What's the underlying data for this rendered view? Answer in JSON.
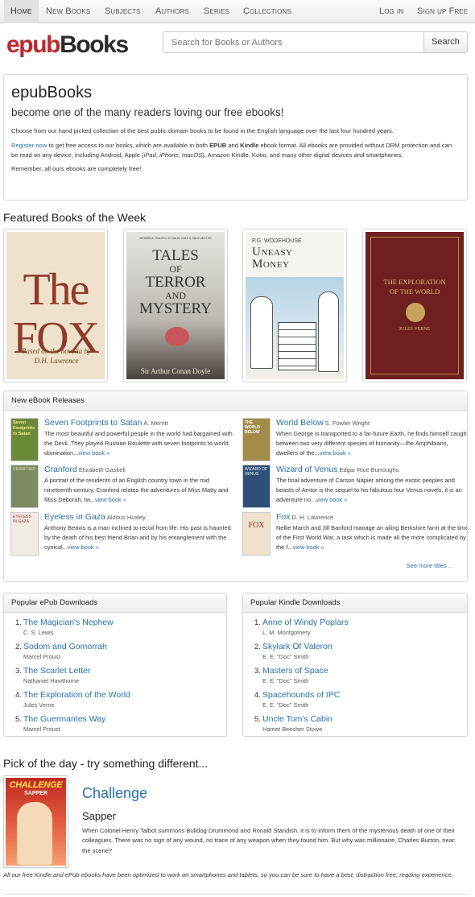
{
  "nav": {
    "home": "Home",
    "new_books": "New Books",
    "subjects": "Subjects",
    "authors": "Authors",
    "series": "Series",
    "collections": "Collections",
    "login": "Log in",
    "signup": "Sign up Free"
  },
  "header": {
    "logo_part1": "epub",
    "logo_part2": "Books",
    "search_placeholder": "Search for Books or Authors",
    "search_button": "Search"
  },
  "intro": {
    "title": "epubBooks",
    "subtitle": "become one of the many readers loving our free ebooks!",
    "para1": "Choose from our hand picked collection of the best public domain books to be found in the English language over the last four hundred years.",
    "register_link": "Register now",
    "para2_a": " to get free access to our books, which are available in both ",
    "epub": "EPUB",
    "and": " and ",
    "kindle": "Kindle",
    "para2_b": " ebook format. All ebooks are provided without DRM protection and can be read on any device, including Android, Apple (",
    "ipad": "iPad",
    "comma1": ", ",
    "iphone": "iPhone",
    "comma2": ", ",
    "macos": "macOS",
    "para2_c": "), Amazon Kindle, Kobo, and many other digital devices and smartphones.",
    "para3": "Remember, all ours ebooks are completely free!"
  },
  "featured": {
    "title": "Featured Books of the Week",
    "books": [
      {
        "cover_title": "The FOX",
        "cover_sub": "Based on the novella by D.H. Lawrence"
      },
      {
        "cover_series": "MEMBRAK TRAJTEO DI SALIK, KALS & SALIK MISTER",
        "cover_title_1": "TALES",
        "cover_title_2": "OF",
        "cover_title_3": "TERROR",
        "cover_title_4": "AND",
        "cover_title_5": "MYSTERY",
        "cover_author": "Sir Arthur Conan Doyle"
      },
      {
        "cover_author": "P.G. WODEHOUSE",
        "cover_title_1": "Uneasy",
        "cover_title_2": "Money"
      },
      {
        "cover_title_1": "THE EXPLORATION",
        "cover_title_2": "OF THE WORLD",
        "cover_author": "JULES VERNE"
      }
    ]
  },
  "releases": {
    "title": "New eBook Releases",
    "see_more": "See more titles ...",
    "view_book": "view book »",
    "items": [
      {
        "title": "Seven Footprints to Satan",
        "author": "A. Merritt",
        "desc": "The most beautiful and powerful people in the world had bargained with the Devil. They played Russian Roulette with seven footprints to world domination...",
        "thumb_text": "Seven Footprints to Satan"
      },
      {
        "title": "World Below",
        "author": "S. Fowler Wright",
        "desc": "When George is transported to a far-future Earth, he finds himself caught between two very different species of humanity—the Amphibians, dwellers of the...",
        "thumb_text": "THE WORLD BELOW"
      },
      {
        "title": "Cranford",
        "author": "Elizabeth Gaskell",
        "desc": "A portrait of the residents of an English country town in the mid nineteenth century, Cranford relates the adventures of Miss Matty and Miss Deborah, tw...",
        "thumb_text": "CRANFORD"
      },
      {
        "title": "Wizard of Venus",
        "author": "Edgar Rice Burroughs",
        "desc": "The final adventure of Carson Napier among the exotic peoples and beasts of Amtor is the sequel to his fabulous four Venus novels, it is an adventure no...",
        "thumb_text": "WIZARD OF VENUS"
      },
      {
        "title": "Eyeless in Gaza",
        "author": "Aldous Huxley",
        "desc": "Anthony Beavis is a man inclined to recoil from life. His past is haunted by the death of his best friend Brian and by his entanglement with the cynical...",
        "thumb_text": "EYELESS IN GAZA"
      },
      {
        "title": "Fox",
        "author": "D. H. Lawrence",
        "desc": "Nellie March and Jill Banford manage an ailing Berkshire farm at the time of the First World War, a task which is made all the more complicated by the f...",
        "thumb_text": "FOX"
      }
    ]
  },
  "popular_epub": {
    "title": "Popular ePub Downloads",
    "items": [
      {
        "num": "1.",
        "title": "The Magician's Nephew",
        "author": "C. S. Lewis"
      },
      {
        "num": "2.",
        "title": "Sodom and Gomorrah",
        "author": "Marcel Proust"
      },
      {
        "num": "3.",
        "title": "The Scarlet Letter",
        "author": "Nathaniel Hawthorne"
      },
      {
        "num": "4.",
        "title": "The Exploration of the World",
        "author": "Jules Verne"
      },
      {
        "num": "5.",
        "title": "The Guermantes Way",
        "author": "Marcel Proust"
      }
    ]
  },
  "popular_kindle": {
    "title": "Popular Kindle Downloads",
    "items": [
      {
        "num": "1.",
        "title": "Anne of Windy Poplars",
        "author": "L. M. Montgomery"
      },
      {
        "num": "2.",
        "title": "Skylark Of Valeron",
        "author": "E. E. \"Doc\" Smith"
      },
      {
        "num": "3.",
        "title": "Masters of Space",
        "author": "E. E. \"Doc\" Smith"
      },
      {
        "num": "4.",
        "title": "Spacehounds of IPC",
        "author": "E. E. \"Doc\" Smith"
      },
      {
        "num": "5.",
        "title": "Uncle Tom's Cabin",
        "author": "Harriet Beecher Stowe"
      }
    ]
  },
  "pick": {
    "heading": "Pick of the day - try something different...",
    "title": "Challenge",
    "author": "Sapper",
    "desc": "When Colonel Henry Talbot summons Bulldog Drummond and Ronald Standish, it is to inform them of the mysterious death of one of their colleagues. There was no sign of any wound, no trace of any weapon when they found him. But why was millionaire, Charles Burton, near the scene?",
    "cover_title": "CHALLENGE",
    "cover_author": "SAPPER"
  },
  "footer_note": "All our free Kindle and ePub ebooks have been optimized to work on smartphones and tablets, so you can be sure to have a best, distraction free, reading experience.",
  "colors": {
    "link": "#2a6fa9",
    "logo_red": "#c0272d",
    "logo_dark": "#2b2b2b"
  }
}
